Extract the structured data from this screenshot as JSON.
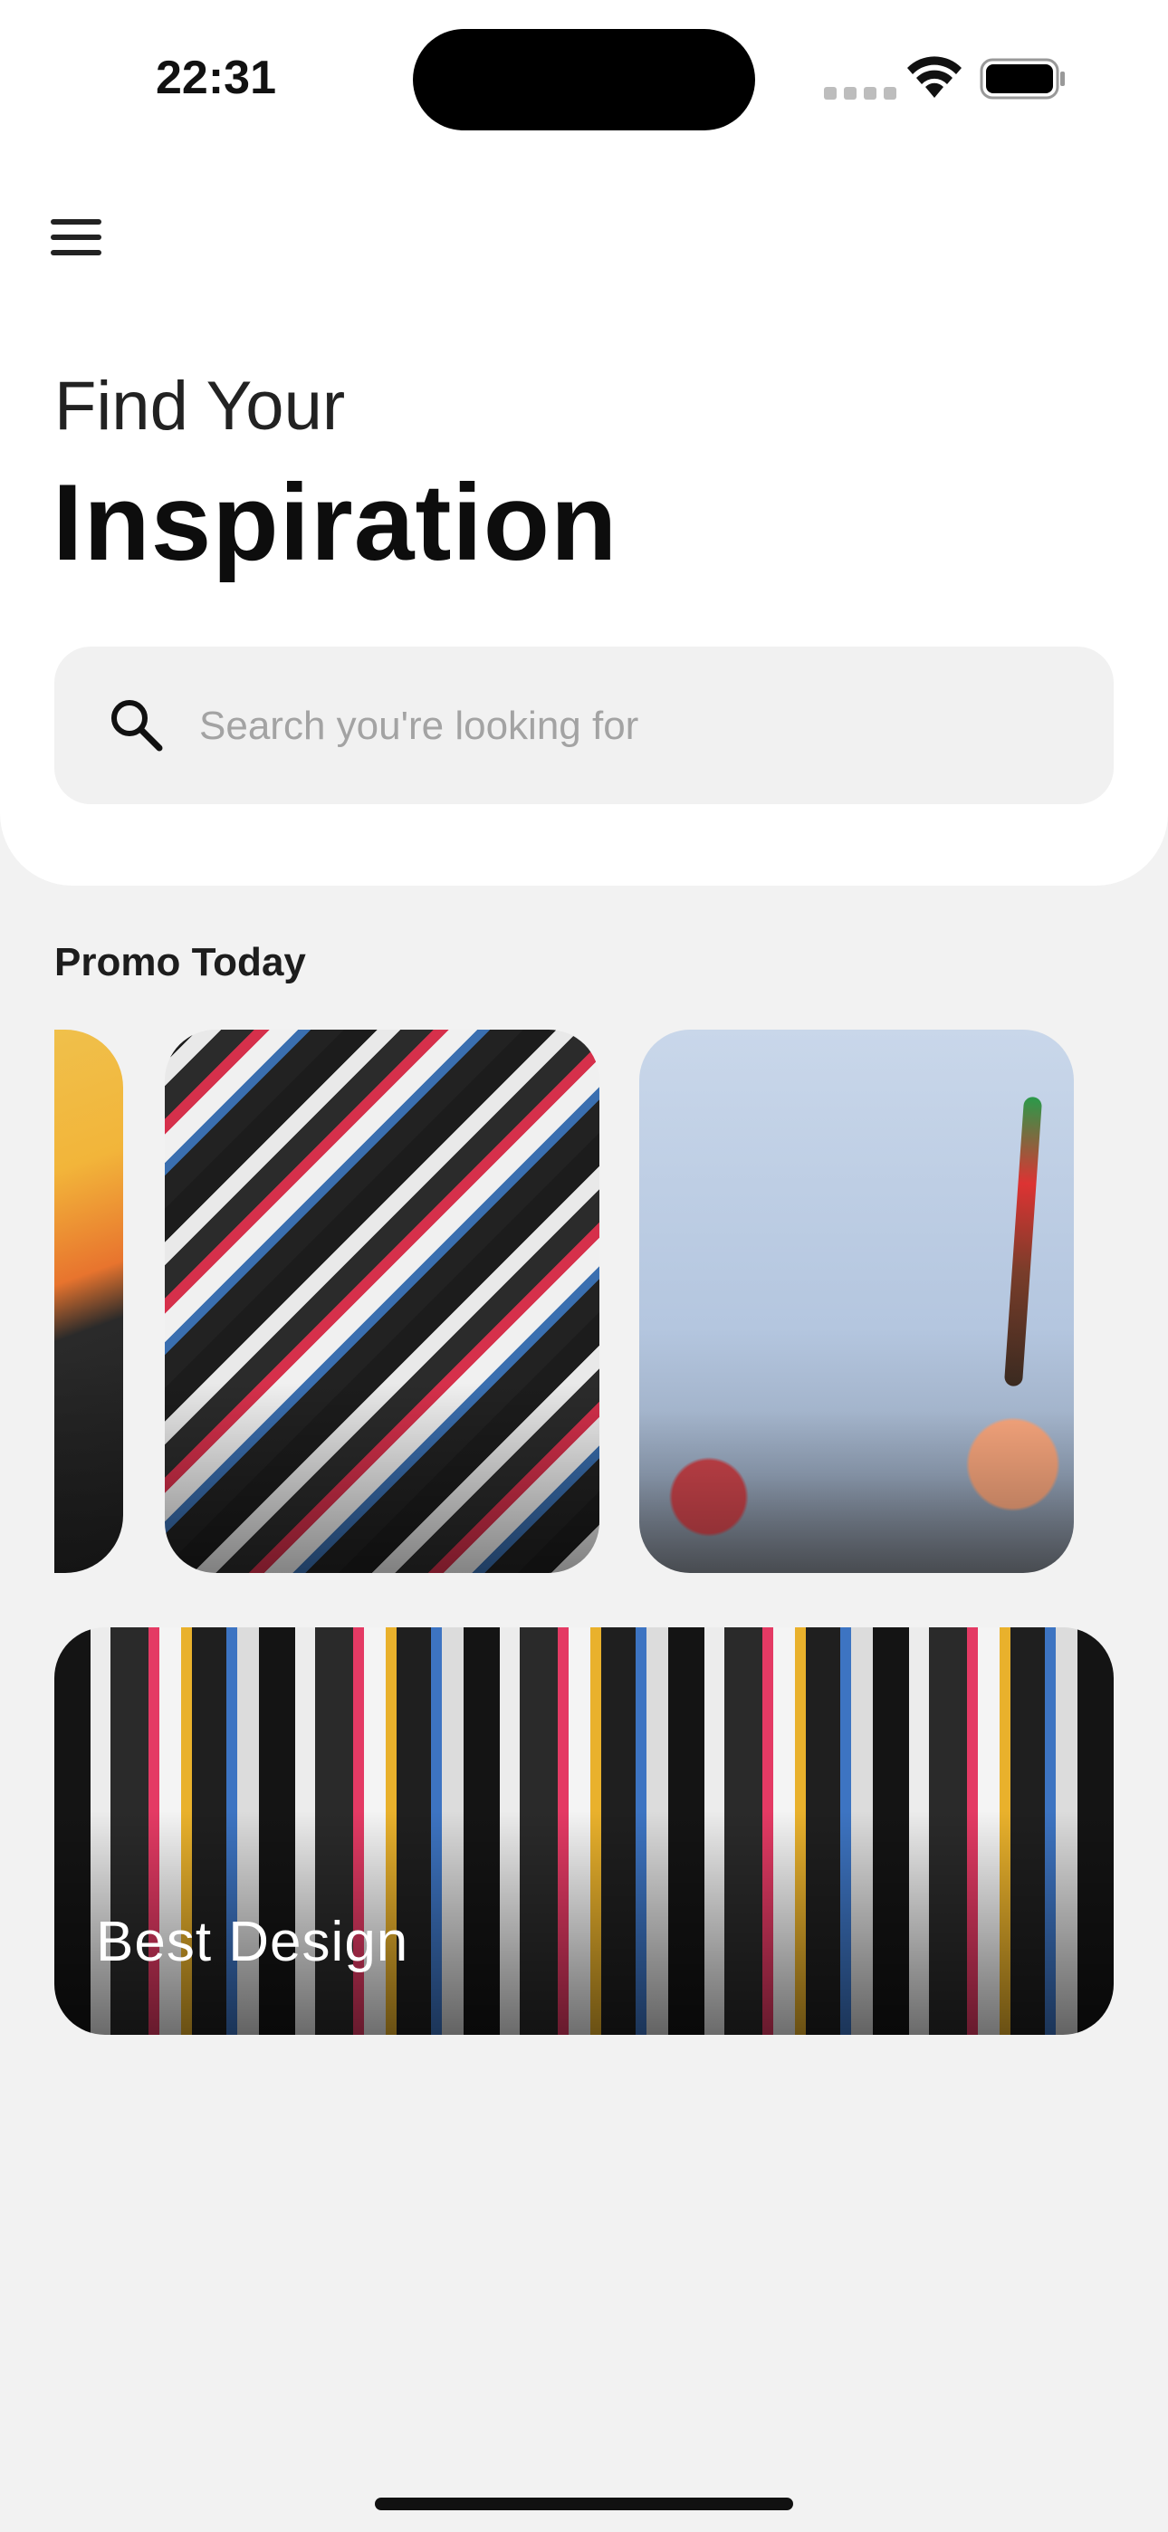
{
  "status_bar": {
    "time": "22:31"
  },
  "header": {
    "menu_icon": "hamburger-menu-icon",
    "subtitle": "Find Your",
    "title": "Inspiration"
  },
  "search": {
    "placeholder": "Search you're looking for",
    "icon": "search-icon"
  },
  "promo": {
    "title": "Promo Today",
    "cards": [
      {
        "image": "orange-scissors-photo"
      },
      {
        "image": "sticker-wall-photo"
      },
      {
        "image": "paint-brush-hands-photo"
      }
    ]
  },
  "banner": {
    "label": "Best Design",
    "image": "sticker-wall-photo"
  },
  "colors": {
    "background": "#f2f2f2",
    "header_background": "#ffffff",
    "search_background": "#f1f1f1",
    "text_primary": "#0d0d0d",
    "placeholder": "#a3a3a3"
  }
}
